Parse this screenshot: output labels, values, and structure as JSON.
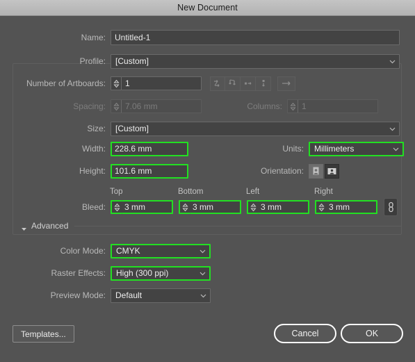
{
  "window": {
    "title": "New Document"
  },
  "form": {
    "name": {
      "label": "Name:",
      "value": "Untitled-1"
    },
    "profile": {
      "label": "Profile:",
      "value": "[Custom]"
    },
    "artboards": {
      "label": "Number of Artboards:",
      "value": "1",
      "arrange_icons": [
        "grid-by-row-icon",
        "grid-by-column-icon",
        "arrange-by-row-icon",
        "arrange-by-column-icon"
      ],
      "direction_icon": "left-to-right-icon"
    },
    "spacing": {
      "label": "Spacing:",
      "value": "7.06 mm",
      "disabled": true
    },
    "columns": {
      "label": "Columns:",
      "value": "1",
      "disabled": true
    },
    "size": {
      "label": "Size:",
      "value": "[Custom]"
    },
    "width": {
      "label": "Width:",
      "value": "228.6 mm",
      "highlighted": true
    },
    "height": {
      "label": "Height:",
      "value": "101.6 mm",
      "highlighted": true
    },
    "units": {
      "label": "Units:",
      "value": "Millimeters",
      "highlighted": true
    },
    "orientation": {
      "label": "Orientation:",
      "portrait_icon": "portrait-orientation-icon",
      "landscape_icon": "landscape-orientation-icon",
      "selected": "landscape"
    },
    "bleed": {
      "label": "Bleed:",
      "headers": {
        "top": "Top",
        "bottom": "Bottom",
        "left": "Left",
        "right": "Right"
      },
      "values": {
        "top": "3 mm",
        "bottom": "3 mm",
        "left": "3 mm",
        "right": "3 mm"
      },
      "link_icon": "chain-link-icon",
      "linked": true
    },
    "advanced": {
      "label": "Advanced",
      "expanded": true,
      "disclosure_icon": "triangle-down-icon",
      "color_mode": {
        "label": "Color Mode:",
        "value": "CMYK",
        "highlighted": true
      },
      "raster_effects": {
        "label": "Raster Effects:",
        "value": "High (300 ppi)",
        "highlighted": true
      },
      "preview_mode": {
        "label": "Preview Mode:",
        "value": "Default",
        "highlighted": false
      }
    }
  },
  "footer": {
    "templates": "Templates...",
    "cancel": "Cancel",
    "ok": "OK"
  },
  "colors": {
    "highlight_green": "#22e022",
    "dialog_bg": "#535353",
    "field_bg": "#434343",
    "titlebar": "#bcbcbc"
  }
}
